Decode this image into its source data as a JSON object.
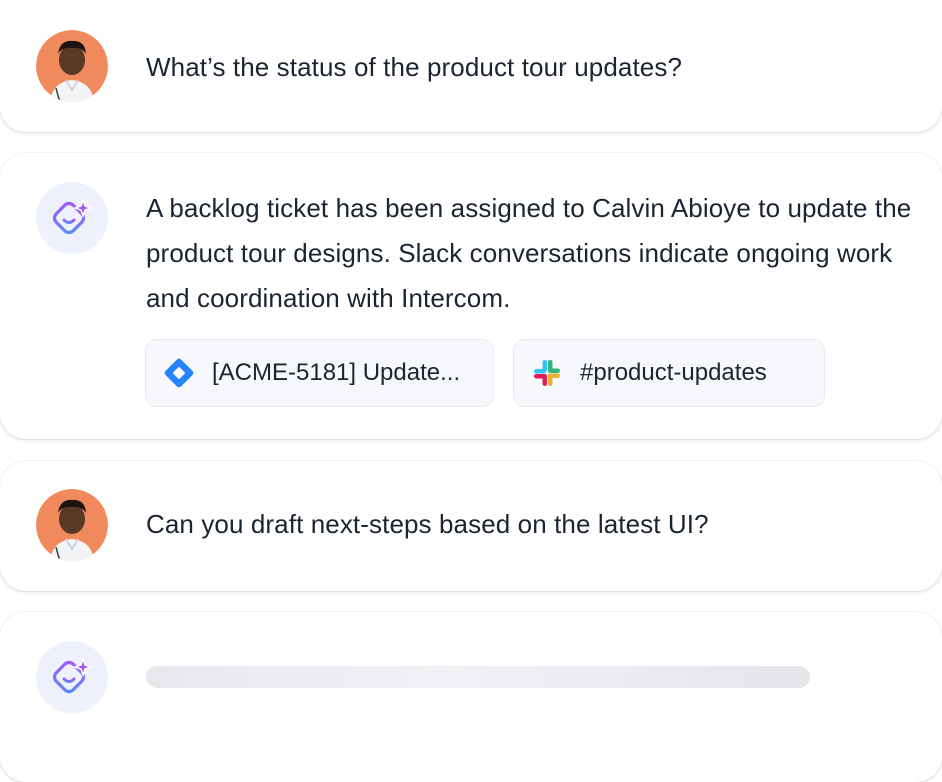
{
  "conversation": [
    {
      "role": "user",
      "text": "What’s the status of the product tour updates?"
    },
    {
      "role": "assistant",
      "text": "A backlog ticket has been assigned to Calvin Abioye to update the product tour designs. Slack conversations indicate ongoing work and coordination with Intercom."
    },
    {
      "role": "user",
      "text": "Can you draft next-steps based on the latest UI?"
    },
    {
      "role": "assistant",
      "state": "loading"
    }
  ],
  "sources": [
    {
      "label": "[ACME-5181] Update...",
      "icon": "jira-icon",
      "color": "#2684ff"
    },
    {
      "label": "#product-updates",
      "icon": "slack-icon"
    }
  ],
  "colors": {
    "text": "#1b2532",
    "ai_badge_bg": "#eef1fb",
    "ai_icon_gradient_start": "#5b8cf7",
    "ai_icon_gradient_end": "#a855f7",
    "avatar_bg": "#f08a5d",
    "chip_bg": "#f6f8fb"
  }
}
